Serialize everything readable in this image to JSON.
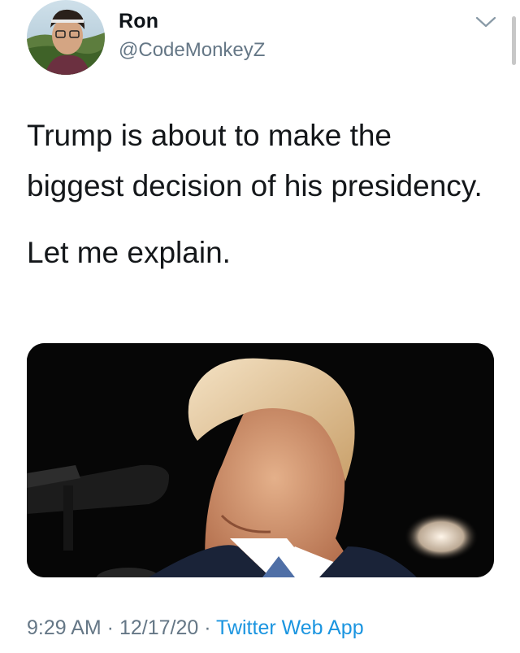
{
  "user": {
    "display_name": "Ron",
    "handle": "@CodeMonkeyZ",
    "avatar": "profile-photo"
  },
  "tweet": {
    "paragraphs": [
      "Trump is about to make the biggest decision of his presidency.",
      "Let me explain."
    ],
    "media": "photo"
  },
  "meta": {
    "time": "9:29 AM",
    "separator": " · ",
    "date": "12/17/20",
    "source": "Twitter Web App"
  },
  "colors": {
    "text": "#14171a",
    "secondary": "#657786",
    "link": "#1b95e0"
  },
  "icons": {
    "caret": "chevron-down-icon"
  }
}
